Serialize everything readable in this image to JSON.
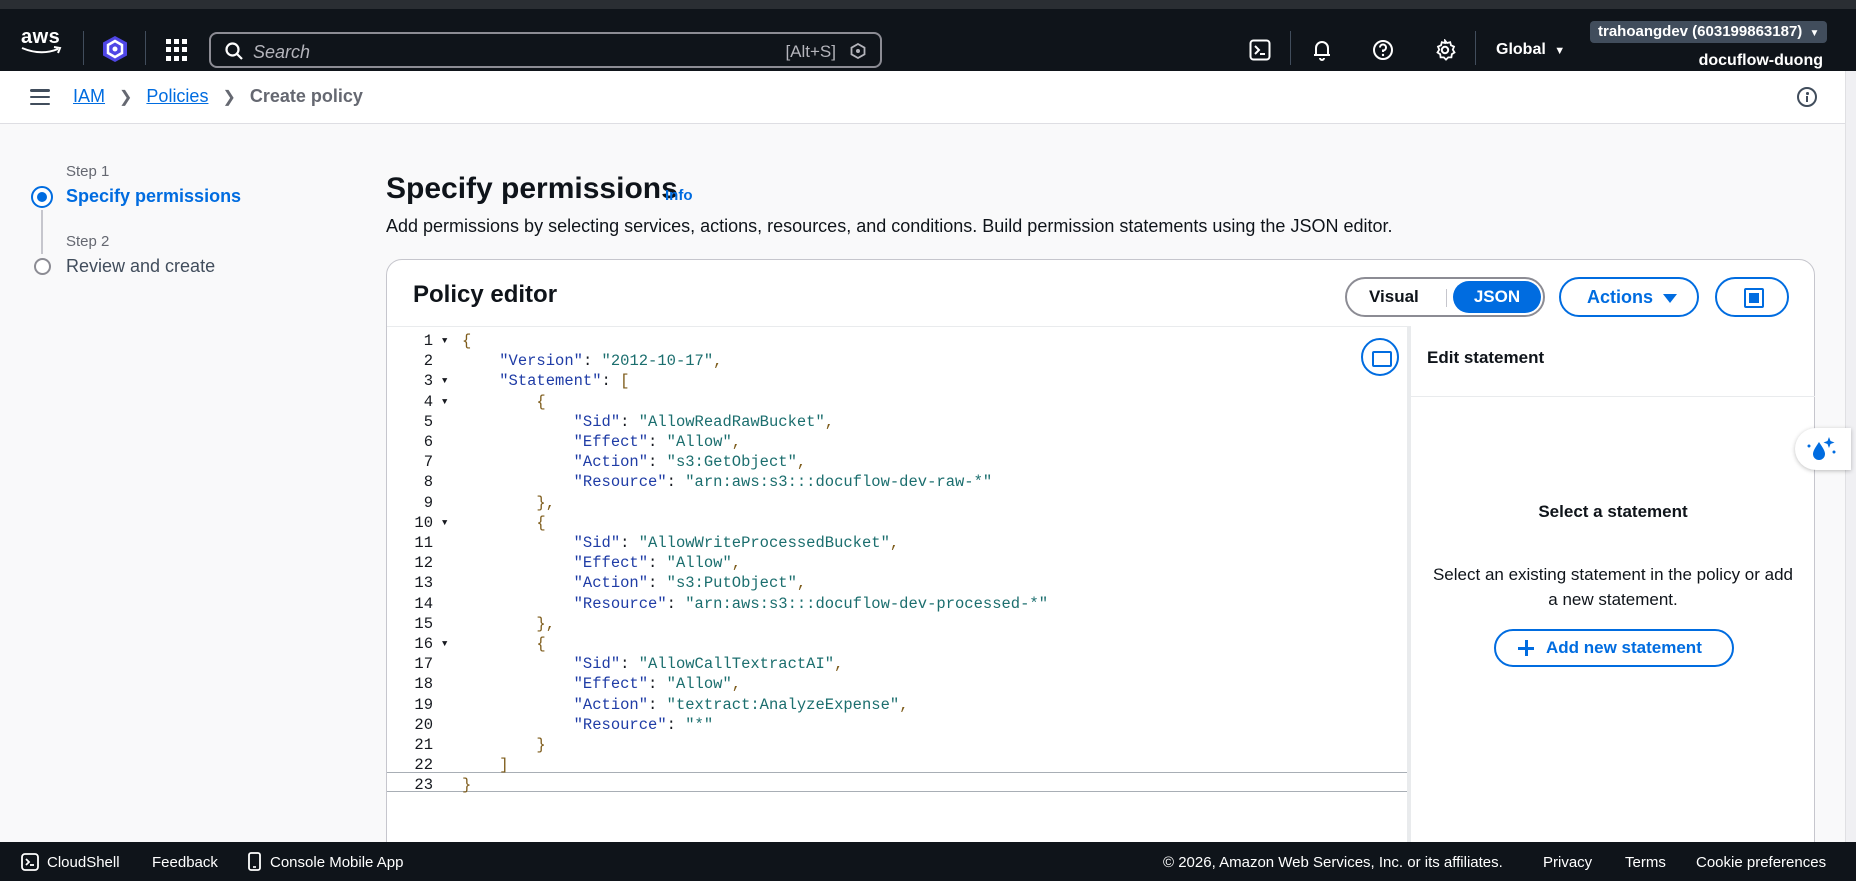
{
  "topnav": {
    "logo_text": "aws",
    "search_placeholder": "Search",
    "search_shortcut": "[Alt+S]",
    "region": "Global",
    "account_name": "trahoangdev (603199863187)",
    "account_sub": "docuflow-duong",
    "icons": [
      "cloudshell-icon",
      "bell-icon",
      "help-icon",
      "gear-icon"
    ]
  },
  "breadcrumb": {
    "items": [
      "IAM",
      "Policies"
    ],
    "current": "Create policy"
  },
  "wizard": {
    "steps": [
      {
        "label": "Step 1",
        "title": "Specify permissions"
      },
      {
        "label": "Step 2",
        "title": "Review and create"
      }
    ]
  },
  "page": {
    "title": "Specify permissions",
    "info": "Info",
    "description": "Add permissions by selecting services, actions, resources, and conditions. Build permission statements using the JSON editor."
  },
  "editor": {
    "title": "Policy editor",
    "visual_label": "Visual",
    "json_label": "JSON",
    "actions_label": "Actions",
    "lines": [
      "{",
      "    \"Version\": \"2012-10-17\",",
      "    \"Statement\": [",
      "        {",
      "            \"Sid\": \"AllowReadRawBucket\",",
      "            \"Effect\": \"Allow\",",
      "            \"Action\": \"s3:GetObject\",",
      "            \"Resource\": \"arn:aws:s3:::docuflow-dev-raw-*\"",
      "        },",
      "        {",
      "            \"Sid\": \"AllowWriteProcessedBucket\",",
      "            \"Effect\": \"Allow\",",
      "            \"Action\": \"s3:PutObject\",",
      "            \"Resource\": \"arn:aws:s3:::docuflow-dev-processed-*\"",
      "        },",
      "        {",
      "            \"Sid\": \"AllowCallTextractAI\",",
      "            \"Effect\": \"Allow\",",
      "            \"Action\": \"textract:AnalyzeExpense\",",
      "            \"Resource\": \"*\"",
      "        }",
      "    ]",
      "}"
    ],
    "fold_lines": [
      1,
      3,
      4,
      10,
      16
    ]
  },
  "statement_panel": {
    "title": "Edit statement",
    "empty_title": "Select a statement",
    "empty_desc": "Select an existing statement in the policy or add a new statement.",
    "add_label": "Add new statement"
  },
  "footer": {
    "cloudshell": "CloudShell",
    "feedback": "Feedback",
    "mobile": "Console Mobile App",
    "copyright": "© 2026, Amazon Web Services, Inc. or its affiliates.",
    "privacy": "Privacy",
    "terms": "Terms",
    "cookies": "Cookie preferences"
  }
}
